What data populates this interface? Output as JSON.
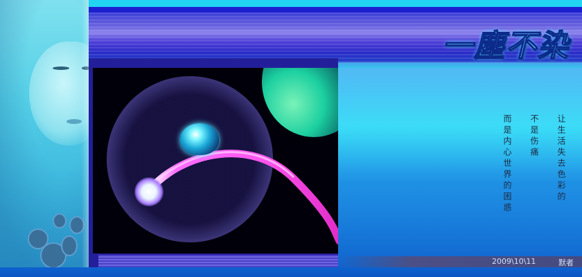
{
  "title": "一塵不染",
  "poem": {
    "lines": [
      "让生活失去色彩的",
      "不是伤痛",
      "而是内心世界的困惑"
    ]
  },
  "footer": {
    "date": "2009\\10\\11",
    "author": "默者"
  },
  "colors": {
    "accent": "#22d4f2",
    "band": "#1b1fd0",
    "frame": "#231f9a",
    "title": "#6fd6ff"
  }
}
